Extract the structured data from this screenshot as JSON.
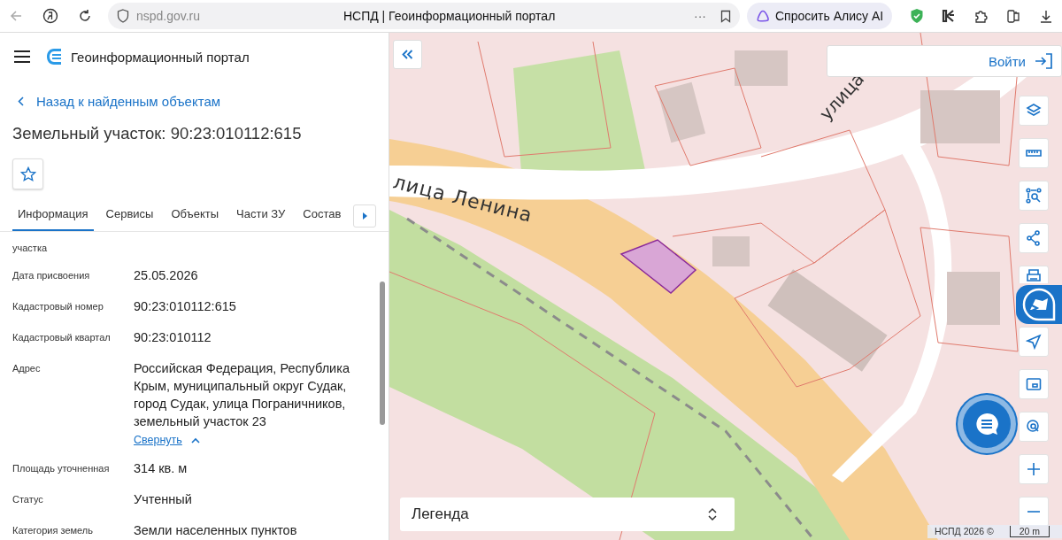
{
  "browser": {
    "url": "nspd.gov.ru",
    "page_title": "НСПД | Геоинформационный портал",
    "more": "···",
    "alice_button": "Спросить Алису AI"
  },
  "app": {
    "title": "Геоинформационный портал"
  },
  "back_link": "Назад к найденным объектам",
  "heading": "Земельный участок: 90:23:010112:615",
  "favorite": {
    "checked": false
  },
  "tabs": [
    {
      "label": "Информация",
      "selected": true
    },
    {
      "label": "Сервисы",
      "selected": false
    },
    {
      "label": "Объекты",
      "selected": false
    },
    {
      "label": "Части ЗУ",
      "selected": false
    },
    {
      "label": "Состав",
      "selected": false
    }
  ],
  "fields": [
    {
      "label": "участка"
    },
    {
      "label": "Дата присвоения",
      "value": "25.05.2026"
    },
    {
      "label": "Кадастровый номер",
      "value": "90:23:010112:615"
    },
    {
      "label": "Кадастровый квартал",
      "value": "90:23:010112"
    },
    {
      "label": "Адрес",
      "value": "Российская Федерация, Республика Крым, муниципальный округ Судак, город Судак, улица Пограничников, земельный участок 23",
      "action": "Свернуть"
    },
    {
      "label": "Площадь уточненная",
      "value": "314 кв. м"
    },
    {
      "label": "Статус",
      "value": "Учтенный"
    },
    {
      "label": "Категория земель",
      "value": "Земли населенных пунктов"
    }
  ],
  "map": {
    "street_labels": [
      {
        "text": "лица Ленина",
        "kind": "main"
      },
      {
        "text": "улица",
        "kind": "side"
      }
    ],
    "login": "Войти",
    "legend": "Легенда",
    "attribution": "НСПД 2026 ©",
    "scale": "20 m"
  }
}
